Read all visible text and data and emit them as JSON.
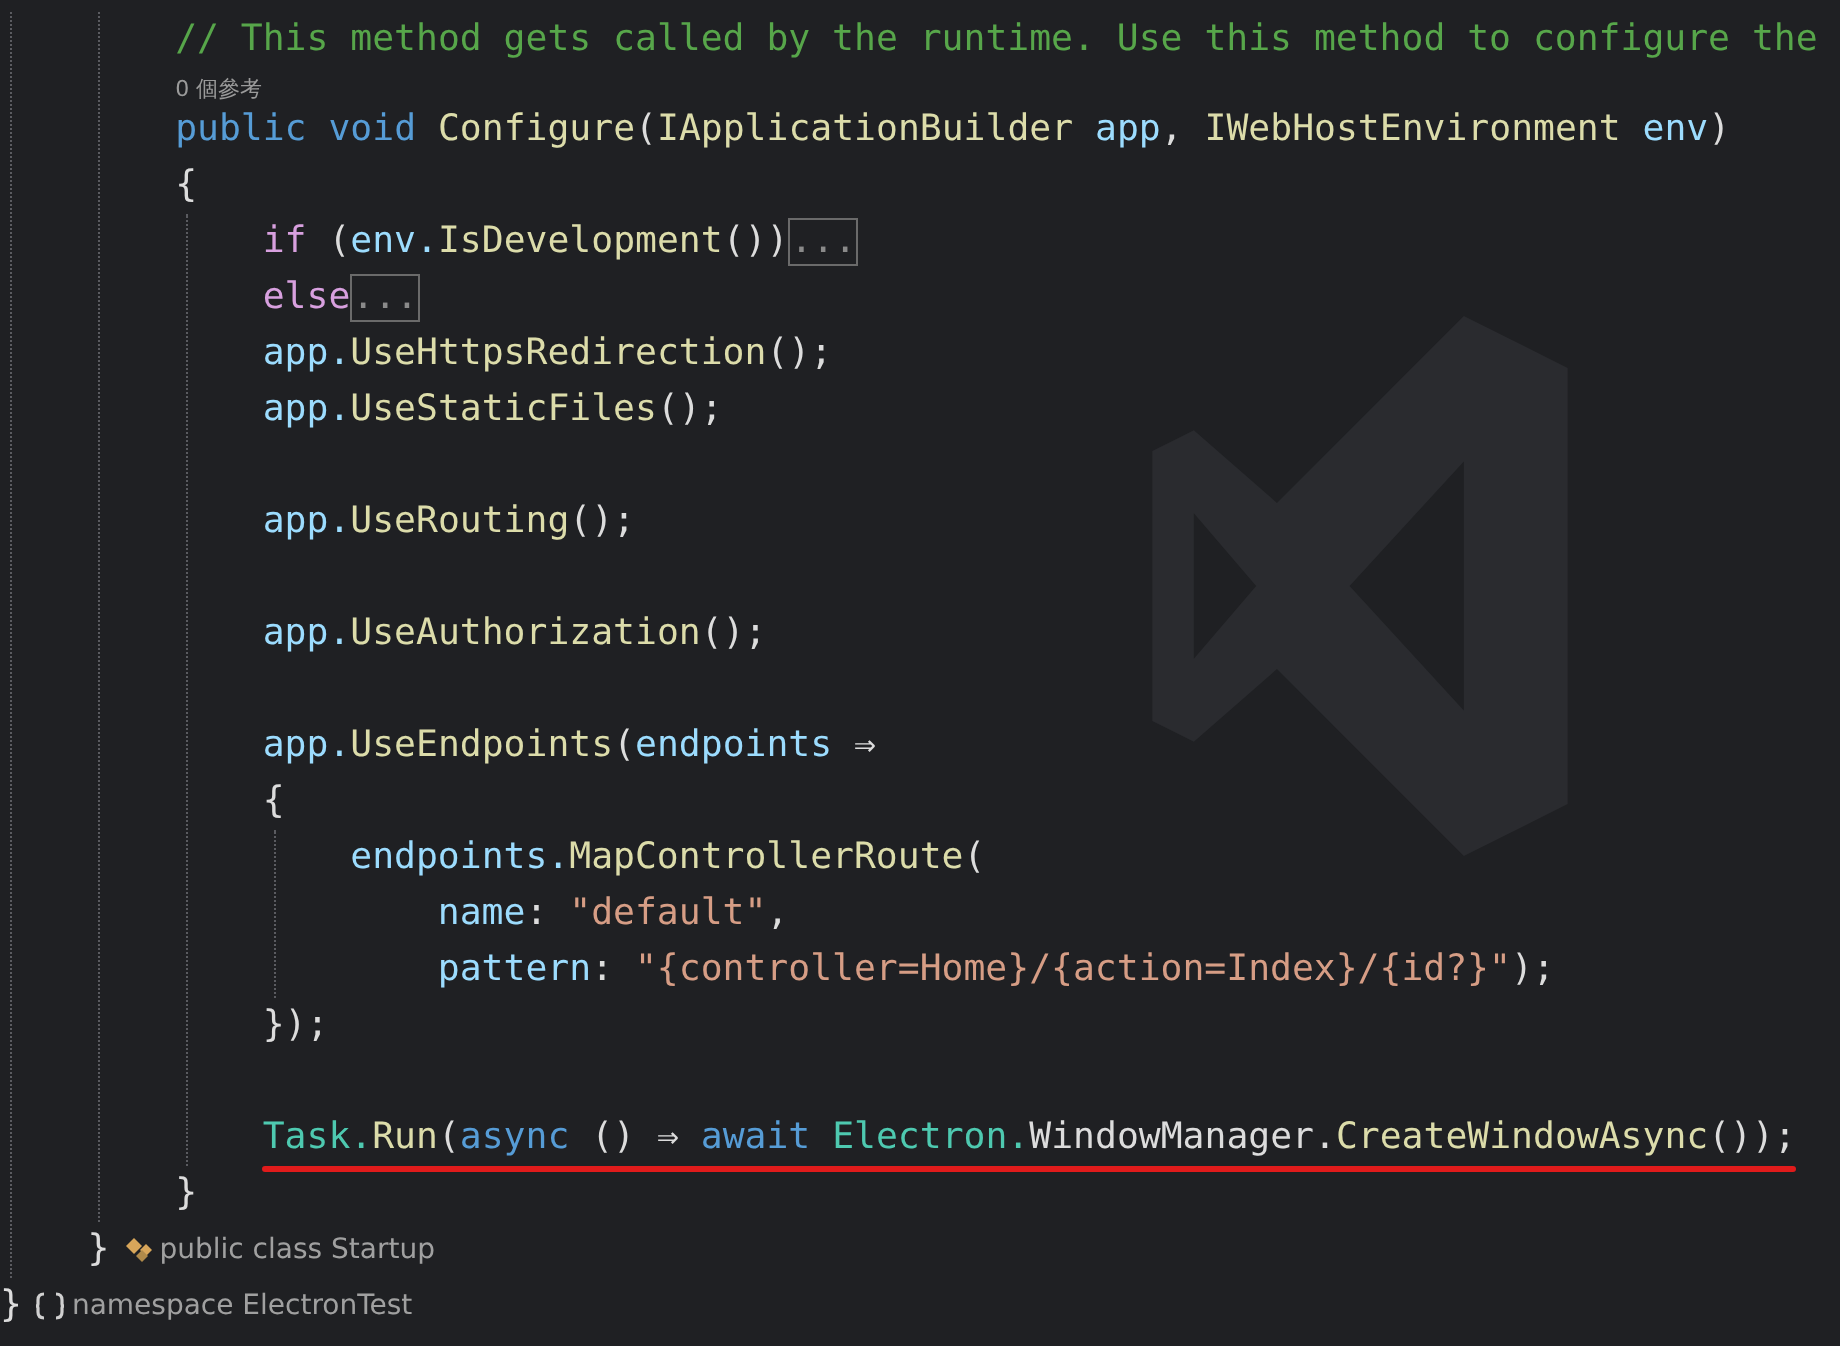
{
  "editor": {
    "lines": [
      {
        "kind": "group",
        "guide": true,
        "children": [
          {
            "kind": "group",
            "guide": true,
            "children": [
              {
                "kind": "code",
                "tokens": [
                  {
                    "kind": "comment",
                    "text": "// This method gets called by the runtime. Use this method to configure the"
                  }
                ]
              },
              {
                "kind": "codelens",
                "text": "0 個參考"
              },
              {
                "kind": "code",
                "tokens": [
                  {
                    "kind": "keyword",
                    "text": "public"
                  },
                  {
                    "kind": "keyword",
                    "text": "void"
                  },
                  {
                    "kind": "method",
                    "text": "Configure"
                  },
                  {
                    "kind": "plain",
                    "text": "("
                  },
                  {
                    "kind": "interface",
                    "text": "IApplicationBuilder"
                  },
                  {
                    "kind": "param",
                    "text": "app"
                  },
                  {
                    "kind": "plain",
                    "text": ","
                  },
                  {
                    "kind": "interface",
                    "text": "IWebHostEnvironment"
                  },
                  {
                    "kind": "param",
                    "text": "env"
                  },
                  {
                    "kind": "plain",
                    "text": ")"
                  }
                ]
              },
              {
                "kind": "code",
                "tokens": [
                  {
                    "kind": "plain",
                    "text": "{"
                  }
                ],
                "guide": true,
                "children": [
                  {
                    "kind": "code",
                    "tokens": [
                      {
                        "kind": "control",
                        "text": "if"
                      },
                      {
                        "kind": "plain",
                        "text": "("
                      },
                      {
                        "kind": "param",
                        "text": "env."
                      },
                      {
                        "kind": "method",
                        "text": "IsDevelopment"
                      },
                      {
                        "kind": "plain",
                        "text": "())"
                      },
                      {
                        "kind": "collapsed",
                        "text": "..."
                      }
                    ]
                  },
                  {
                    "kind": "code",
                    "tokens": [
                      {
                        "kind": "control",
                        "text": "else"
                      },
                      {
                        "kind": "collapsed",
                        "text": "..."
                      }
                    ]
                  },
                  {
                    "kind": "code",
                    "tokens": [
                      {
                        "kind": "param",
                        "text": "app."
                      },
                      {
                        "kind": "method",
                        "text": "UseHttpsRedirection"
                      },
                      {
                        "kind": "plain",
                        "text": "();"
                      }
                    ]
                  },
                  {
                    "kind": "code",
                    "tokens": [
                      {
                        "kind": "param",
                        "text": "app."
                      },
                      {
                        "kind": "method",
                        "text": "UseStaticFiles"
                      },
                      {
                        "kind": "plain",
                        "text": "();"
                      }
                    ]
                  },
                  {
                    "kind": "blank"
                  },
                  {
                    "kind": "code",
                    "tokens": [
                      {
                        "kind": "param",
                        "text": "app."
                      },
                      {
                        "kind": "method",
                        "text": "UseRouting"
                      },
                      {
                        "kind": "plain",
                        "text": "();"
                      }
                    ]
                  },
                  {
                    "kind": "blank"
                  },
                  {
                    "kind": "code",
                    "tokens": [
                      {
                        "kind": "param",
                        "text": "app."
                      },
                      {
                        "kind": "method",
                        "text": "UseAuthorization"
                      },
                      {
                        "kind": "plain",
                        "text": "();"
                      }
                    ]
                  },
                  {
                    "kind": "blank"
                  },
                  {
                    "kind": "code",
                    "tokens": [
                      {
                        "kind": "param",
                        "text": "app."
                      },
                      {
                        "kind": "method",
                        "text": "UseEndpoints"
                      },
                      {
                        "kind": "plain",
                        "text": "("
                      },
                      {
                        "kind": "param",
                        "text": "endpoints"
                      },
                      {
                        "kind": "plain",
                        "text": "⇒"
                      }
                    ]
                  },
                  {
                    "kind": "code",
                    "tokens": [
                      {
                        "kind": "plain",
                        "text": "{"
                      }
                    ],
                    "guide": true,
                    "children": [
                      {
                        "kind": "code",
                        "tokens": [
                          {
                            "kind": "param",
                            "text": "endpoints."
                          },
                          {
                            "kind": "method",
                            "text": "MapControllerRoute"
                          },
                          {
                            "kind": "plain",
                            "text": "("
                          }
                        ],
                        "children": [
                          {
                            "kind": "code",
                            "tokens": [
                              {
                                "kind": "param",
                                "text": "name"
                              },
                              {
                                "kind": "plain",
                                "text": ":"
                              },
                              {
                                "kind": "string",
                                "text": "\"default\""
                              },
                              {
                                "kind": "plain",
                                "text": ","
                              }
                            ]
                          },
                          {
                            "kind": "code",
                            "tokens": [
                              {
                                "kind": "param",
                                "text": "pattern"
                              },
                              {
                                "kind": "plain",
                                "text": ":"
                              },
                              {
                                "kind": "string",
                                "text": "\"{controller=Home}/{action=Index}/{id?}\""
                              },
                              {
                                "kind": "plain",
                                "text": ");"
                              }
                            ]
                          }
                        ]
                      }
                    ]
                  },
                  {
                    "kind": "code",
                    "tokens": [
                      {
                        "kind": "plain",
                        "text": "});"
                      }
                    ]
                  },
                  {
                    "kind": "blank"
                  },
                  {
                    "kind": "code",
                    "underlined": true,
                    "tokens": [
                      {
                        "kind": "type",
                        "text": "Task."
                      },
                      {
                        "kind": "method",
                        "text": "Run"
                      },
                      {
                        "kind": "plain",
                        "text": "("
                      },
                      {
                        "kind": "keyword",
                        "text": "async"
                      },
                      {
                        "kind": "plain",
                        "text": "()"
                      },
                      {
                        "kind": "plain",
                        "text": "⇒"
                      },
                      {
                        "kind": "keyword",
                        "text": "await"
                      },
                      {
                        "kind": "type",
                        "text": "Electron."
                      },
                      {
                        "kind": "plain",
                        "text": "WindowManager."
                      },
                      {
                        "kind": "method",
                        "text": "CreateWindowAsync"
                      },
                      {
                        "kind": "plain",
                        "text": "());"
                      }
                    ]
                  }
                ]
              },
              {
                "kind": "code",
                "tokens": [
                  {
                    "kind": "plain",
                    "text": "}"
                  }
                ]
              }
            ]
          },
          {
            "kind": "code",
            "tokens": [
              {
                "kind": "plain",
                "text": "}"
              },
              {
                "kind": "class_hint",
                "text": "public class Startup"
              }
            ]
          }
        ]
      },
      {
        "kind": "code",
        "tokens": [
          {
            "kind": "plain",
            "text": "}"
          },
          {
            "kind": "namespace_hint",
            "text": "namespace ElectronTest"
          }
        ]
      }
    ]
  }
}
